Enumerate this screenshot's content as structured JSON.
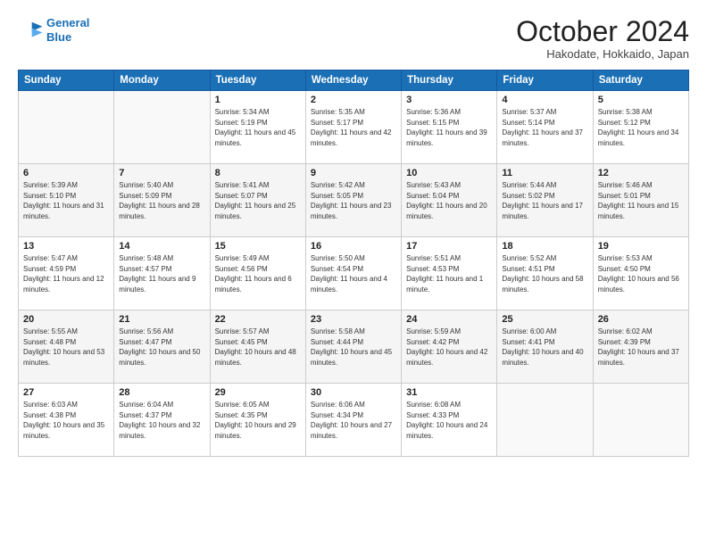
{
  "header": {
    "logo_line1": "General",
    "logo_line2": "Blue",
    "month_title": "October 2024",
    "location": "Hakodate, Hokkaido, Japan"
  },
  "weekdays": [
    "Sunday",
    "Monday",
    "Tuesday",
    "Wednesday",
    "Thursday",
    "Friday",
    "Saturday"
  ],
  "weeks": [
    [
      {
        "day": "",
        "info": ""
      },
      {
        "day": "",
        "info": ""
      },
      {
        "day": "1",
        "info": "Sunrise: 5:34 AM\nSunset: 5:19 PM\nDaylight: 11 hours and 45 minutes."
      },
      {
        "day": "2",
        "info": "Sunrise: 5:35 AM\nSunset: 5:17 PM\nDaylight: 11 hours and 42 minutes."
      },
      {
        "day": "3",
        "info": "Sunrise: 5:36 AM\nSunset: 5:15 PM\nDaylight: 11 hours and 39 minutes."
      },
      {
        "day": "4",
        "info": "Sunrise: 5:37 AM\nSunset: 5:14 PM\nDaylight: 11 hours and 37 minutes."
      },
      {
        "day": "5",
        "info": "Sunrise: 5:38 AM\nSunset: 5:12 PM\nDaylight: 11 hours and 34 minutes."
      }
    ],
    [
      {
        "day": "6",
        "info": "Sunrise: 5:39 AM\nSunset: 5:10 PM\nDaylight: 11 hours and 31 minutes."
      },
      {
        "day": "7",
        "info": "Sunrise: 5:40 AM\nSunset: 5:09 PM\nDaylight: 11 hours and 28 minutes."
      },
      {
        "day": "8",
        "info": "Sunrise: 5:41 AM\nSunset: 5:07 PM\nDaylight: 11 hours and 25 minutes."
      },
      {
        "day": "9",
        "info": "Sunrise: 5:42 AM\nSunset: 5:05 PM\nDaylight: 11 hours and 23 minutes."
      },
      {
        "day": "10",
        "info": "Sunrise: 5:43 AM\nSunset: 5:04 PM\nDaylight: 11 hours and 20 minutes."
      },
      {
        "day": "11",
        "info": "Sunrise: 5:44 AM\nSunset: 5:02 PM\nDaylight: 11 hours and 17 minutes."
      },
      {
        "day": "12",
        "info": "Sunrise: 5:46 AM\nSunset: 5:01 PM\nDaylight: 11 hours and 15 minutes."
      }
    ],
    [
      {
        "day": "13",
        "info": "Sunrise: 5:47 AM\nSunset: 4:59 PM\nDaylight: 11 hours and 12 minutes."
      },
      {
        "day": "14",
        "info": "Sunrise: 5:48 AM\nSunset: 4:57 PM\nDaylight: 11 hours and 9 minutes."
      },
      {
        "day": "15",
        "info": "Sunrise: 5:49 AM\nSunset: 4:56 PM\nDaylight: 11 hours and 6 minutes."
      },
      {
        "day": "16",
        "info": "Sunrise: 5:50 AM\nSunset: 4:54 PM\nDaylight: 11 hours and 4 minutes."
      },
      {
        "day": "17",
        "info": "Sunrise: 5:51 AM\nSunset: 4:53 PM\nDaylight: 11 hours and 1 minute."
      },
      {
        "day": "18",
        "info": "Sunrise: 5:52 AM\nSunset: 4:51 PM\nDaylight: 10 hours and 58 minutes."
      },
      {
        "day": "19",
        "info": "Sunrise: 5:53 AM\nSunset: 4:50 PM\nDaylight: 10 hours and 56 minutes."
      }
    ],
    [
      {
        "day": "20",
        "info": "Sunrise: 5:55 AM\nSunset: 4:48 PM\nDaylight: 10 hours and 53 minutes."
      },
      {
        "day": "21",
        "info": "Sunrise: 5:56 AM\nSunset: 4:47 PM\nDaylight: 10 hours and 50 minutes."
      },
      {
        "day": "22",
        "info": "Sunrise: 5:57 AM\nSunset: 4:45 PM\nDaylight: 10 hours and 48 minutes."
      },
      {
        "day": "23",
        "info": "Sunrise: 5:58 AM\nSunset: 4:44 PM\nDaylight: 10 hours and 45 minutes."
      },
      {
        "day": "24",
        "info": "Sunrise: 5:59 AM\nSunset: 4:42 PM\nDaylight: 10 hours and 42 minutes."
      },
      {
        "day": "25",
        "info": "Sunrise: 6:00 AM\nSunset: 4:41 PM\nDaylight: 10 hours and 40 minutes."
      },
      {
        "day": "26",
        "info": "Sunrise: 6:02 AM\nSunset: 4:39 PM\nDaylight: 10 hours and 37 minutes."
      }
    ],
    [
      {
        "day": "27",
        "info": "Sunrise: 6:03 AM\nSunset: 4:38 PM\nDaylight: 10 hours and 35 minutes."
      },
      {
        "day": "28",
        "info": "Sunrise: 6:04 AM\nSunset: 4:37 PM\nDaylight: 10 hours and 32 minutes."
      },
      {
        "day": "29",
        "info": "Sunrise: 6:05 AM\nSunset: 4:35 PM\nDaylight: 10 hours and 29 minutes."
      },
      {
        "day": "30",
        "info": "Sunrise: 6:06 AM\nSunset: 4:34 PM\nDaylight: 10 hours and 27 minutes."
      },
      {
        "day": "31",
        "info": "Sunrise: 6:08 AM\nSunset: 4:33 PM\nDaylight: 10 hours and 24 minutes."
      },
      {
        "day": "",
        "info": ""
      },
      {
        "day": "",
        "info": ""
      }
    ]
  ]
}
